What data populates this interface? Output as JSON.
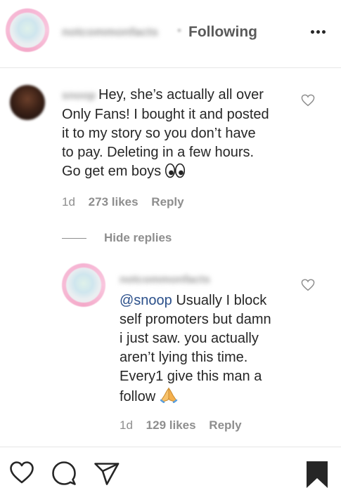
{
  "header": {
    "account_name_blurred": "notcommonfacts",
    "separator": "•",
    "following_label": "Following",
    "more_icon": "more-horizontal-icon"
  },
  "comment": {
    "username_blurred": "snoop",
    "lines": [
      "Hey, she’s actually all over",
      "Only Fans! I bought it and posted",
      "it to my story so you don’t have",
      "to pay. Deleting in a few hours.",
      "Go get em boys"
    ],
    "emoji": "eyes-emoji",
    "time": "1d",
    "likes": "273 likes",
    "reply_label": "Reply"
  },
  "hide_replies_label": "Hide replies",
  "reply": {
    "username_blurred": "notcommonfacts",
    "mention": "@snoop",
    "lines_first_rest": " Usually I block",
    "lines": [
      "self promoters but damn",
      "i just saw. you actually",
      "aren’t lying this time.",
      "Every1 give this man a",
      "follow"
    ],
    "emoji": "folded-hands-emoji",
    "time": "1d",
    "likes": "129 likes",
    "reply_label": "Reply"
  },
  "bottom_bar": {
    "icons": [
      "heart-icon",
      "comment-icon",
      "share-icon",
      "bookmark-icon"
    ]
  },
  "colors": {
    "text": "#262626",
    "secondary": "#8e8e8e",
    "mention": "#2a4f8a",
    "divider": "#e6e6e6"
  }
}
